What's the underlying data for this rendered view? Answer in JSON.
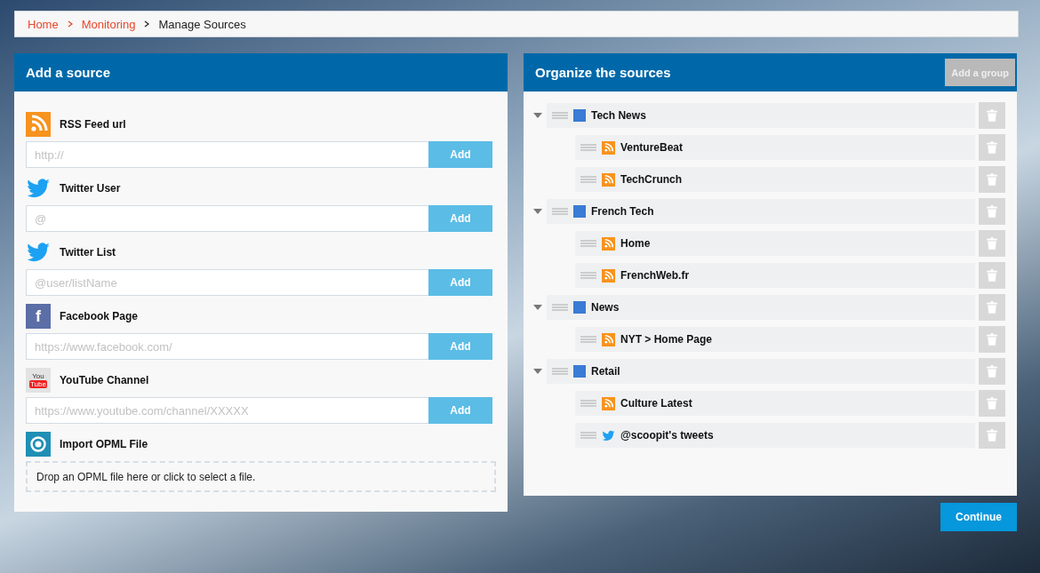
{
  "breadcrumb": [
    {
      "label": "Home",
      "kind": "link"
    },
    {
      "label": "Monitoring",
      "kind": "link"
    },
    {
      "label": "Manage Sources",
      "kind": "current"
    }
  ],
  "add_panel": {
    "title": "Add a source",
    "sources": [
      {
        "kind": "rss",
        "label": "RSS Feed url",
        "placeholder": "http://",
        "button": "Add"
      },
      {
        "kind": "twitter",
        "label": "Twitter User",
        "placeholder": "@",
        "button": "Add"
      },
      {
        "kind": "twitter",
        "label": "Twitter List",
        "placeholder": "@user/listName",
        "button": "Add"
      },
      {
        "kind": "facebook",
        "label": "Facebook Page",
        "placeholder": "https://www.facebook.com/",
        "button": "Add",
        "icon_text": [
          "f"
        ]
      },
      {
        "kind": "youtube",
        "label": "YouTube Channel",
        "placeholder": "https://www.youtube.com/channel/XXXXX",
        "button": "Add",
        "icon_text": [
          "You",
          "Tube"
        ]
      },
      {
        "kind": "opml",
        "label": "Import OPML File",
        "dropzone": "Drop an OPML file here or click to select a file."
      }
    ]
  },
  "organize_panel": {
    "title": "Organize the sources",
    "add_group_button": "Add a group",
    "groups": [
      {
        "name": "Tech News",
        "expanded": true,
        "children": [
          {
            "name": "VentureBeat",
            "kind": "rss"
          },
          {
            "name": "TechCrunch",
            "kind": "rss"
          }
        ]
      },
      {
        "name": "French Tech",
        "expanded": true,
        "children": [
          {
            "name": "Home",
            "kind": "rss"
          },
          {
            "name": "FrenchWeb.fr",
            "kind": "rss"
          }
        ]
      },
      {
        "name": "News",
        "expanded": true,
        "children": [
          {
            "name": "NYT > Home Page",
            "kind": "rss"
          }
        ]
      },
      {
        "name": "Retail",
        "expanded": true,
        "children": [
          {
            "name": "Culture Latest",
            "kind": "rss"
          },
          {
            "name": "@scoopit's tweets",
            "kind": "twitter"
          }
        ]
      }
    ]
  },
  "continue_button": "Continue"
}
